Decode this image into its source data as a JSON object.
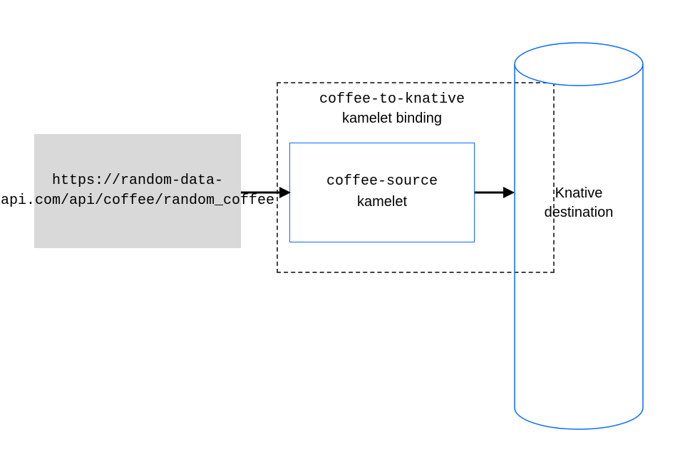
{
  "source": {
    "label": "https://random-data-api.com/api/coffee/random_coffee"
  },
  "binding": {
    "code_name": "coffee-to-knative",
    "subtitle": "kamelet binding"
  },
  "kamelet": {
    "code_name": "coffee-source",
    "subtitle": "kamelet"
  },
  "destination": {
    "line1": "Knative",
    "line2": "destination"
  }
}
